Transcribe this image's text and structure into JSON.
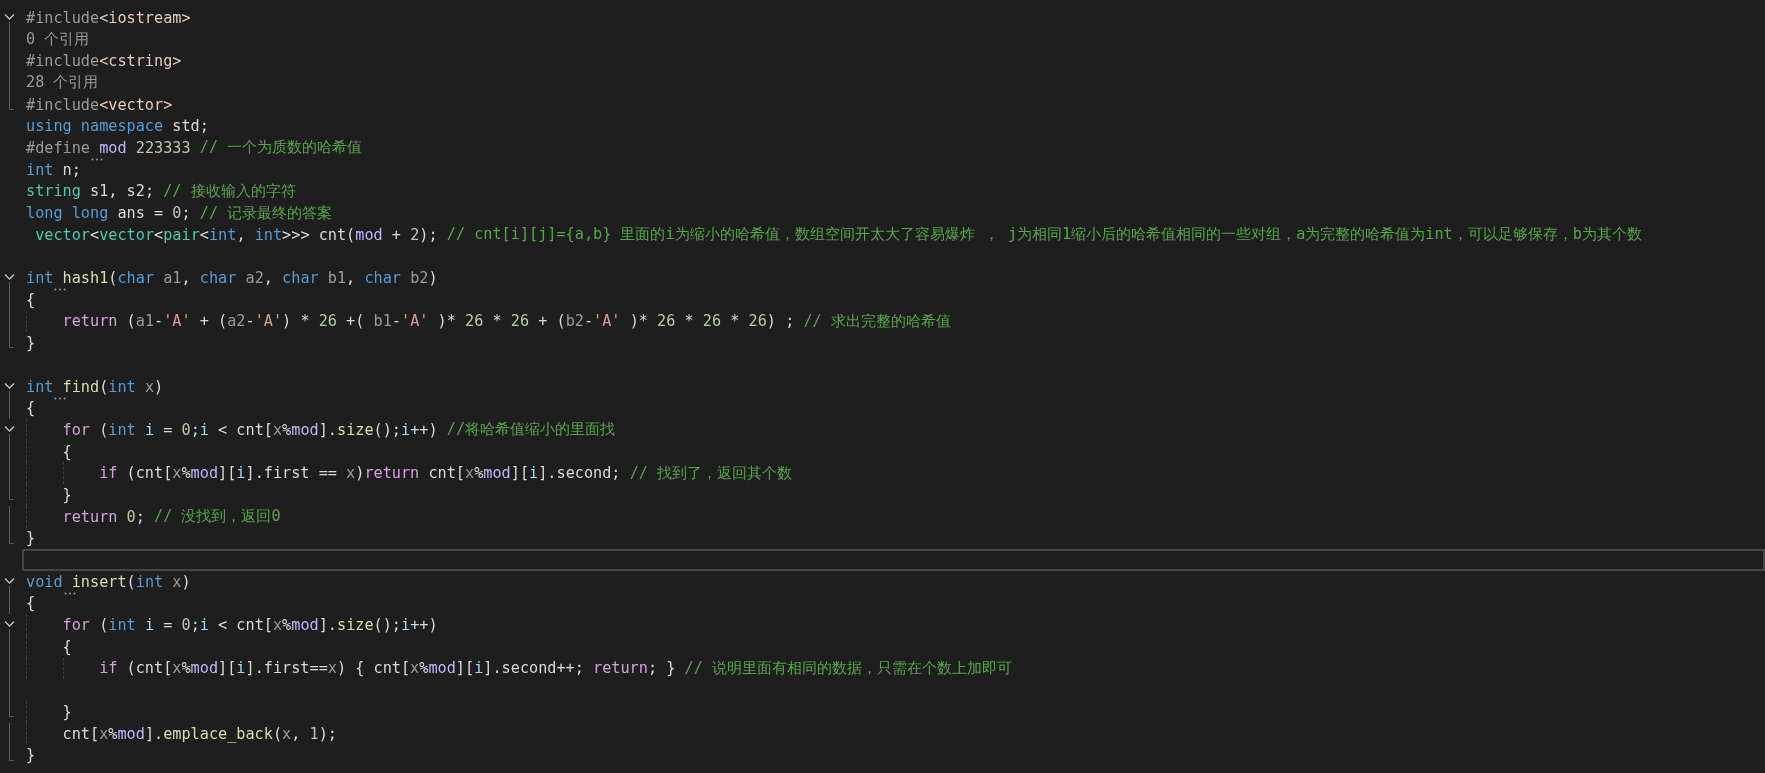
{
  "editor": {
    "lines": [
      {
        "fold_start": true,
        "fold_body": false,
        "fold_end": false,
        "current": false,
        "tokens": [
          {
            "t": "#include",
            "kind": "preprocessor"
          },
          {
            "t": "<iostream>",
            "kind": "include-path"
          }
        ]
      },
      {
        "fold_start": false,
        "fold_body": true,
        "fold_end": false,
        "current": false,
        "tokens": [
          {
            "t": "0 个引用",
            "kind": "codelens"
          }
        ]
      },
      {
        "fold_start": false,
        "fold_body": true,
        "fold_end": false,
        "current": false,
        "tokens": [
          {
            "t": "#include",
            "kind": "preprocessor"
          },
          {
            "t": "<cstring>",
            "kind": "include-path"
          }
        ]
      },
      {
        "fold_start": false,
        "fold_body": true,
        "fold_end": false,
        "current": false,
        "tokens": [
          {
            "t": "28 个引用",
            "kind": "codelens"
          }
        ]
      },
      {
        "fold_start": false,
        "fold_body": false,
        "fold_end": true,
        "current": false,
        "tokens": [
          {
            "t": "#include",
            "kind": "preprocessor"
          },
          {
            "t": "<vector>",
            "kind": "include-path"
          }
        ]
      },
      {
        "fold_start": false,
        "fold_body": false,
        "fold_end": false,
        "current": false,
        "tokens": [
          {
            "t": "using",
            "kind": "keyword"
          },
          {
            "t": " namespace",
            "kind": "keyword"
          },
          {
            "t": " std;",
            "kind": "plain"
          }
        ]
      },
      {
        "fold_start": false,
        "fold_body": false,
        "fold_end": false,
        "current": false,
        "tokens": [
          {
            "t": "#define",
            "kind": "preprocessor"
          },
          {
            "t": " mod",
            "kind": "macro",
            "hint": true
          },
          {
            "t": " 223333",
            "kind": "number"
          },
          {
            "t": " // 一个为质数的哈希值",
            "kind": "comment"
          }
        ]
      },
      {
        "fold_start": false,
        "fold_body": false,
        "fold_end": false,
        "current": false,
        "tokens": [
          {
            "t": "int",
            "kind": "keyword"
          },
          {
            "t": " n;",
            "kind": "plain"
          }
        ]
      },
      {
        "fold_start": false,
        "fold_body": false,
        "fold_end": false,
        "current": false,
        "tokens": [
          {
            "t": "string",
            "kind": "type"
          },
          {
            "t": " s1, s2;",
            "kind": "plain"
          },
          {
            "t": " // 接收输入的字符",
            "kind": "comment"
          }
        ]
      },
      {
        "fold_start": false,
        "fold_body": false,
        "fold_end": false,
        "current": false,
        "tokens": [
          {
            "t": "long long",
            "kind": "keyword"
          },
          {
            "t": " ans = ",
            "kind": "plain"
          },
          {
            "t": "0",
            "kind": "number"
          },
          {
            "t": ";",
            "kind": "plain"
          },
          {
            "t": " // 记录最终的答案",
            "kind": "comment"
          }
        ]
      },
      {
        "fold_start": false,
        "fold_body": false,
        "fold_end": false,
        "current": false,
        "tokens": [
          {
            "t": " vector",
            "kind": "type"
          },
          {
            "t": "<",
            "kind": "plain"
          },
          {
            "t": "vector",
            "kind": "type"
          },
          {
            "t": "<",
            "kind": "plain"
          },
          {
            "t": "pair",
            "kind": "type"
          },
          {
            "t": "<",
            "kind": "plain"
          },
          {
            "t": "int",
            "kind": "keyword"
          },
          {
            "t": ", ",
            "kind": "plain"
          },
          {
            "t": "int",
            "kind": "keyword"
          },
          {
            "t": ">>> cnt(",
            "kind": "plain"
          },
          {
            "t": "mod",
            "kind": "macro"
          },
          {
            "t": " + ",
            "kind": "plain"
          },
          {
            "t": "2",
            "kind": "number"
          },
          {
            "t": ");",
            "kind": "plain"
          },
          {
            "t": " // cnt[i][j]={a,b} 里面的i为缩小的哈希值，数组空间开太大了容易爆炸 ， j为相同1缩小后的哈希值相同的一些对组，a为完整的哈希值为int，可以足够保存，b为其个数",
            "kind": "comment"
          }
        ]
      },
      {
        "fold_start": false,
        "fold_body": false,
        "fold_end": false,
        "current": false
      },
      {
        "fold_start": true,
        "fold_body": false,
        "fold_end": false,
        "current": false,
        "tokens": [
          {
            "t": "int",
            "kind": "keyword"
          },
          {
            "t": " hash1",
            "kind": "function",
            "hint": true
          },
          {
            "t": "(",
            "kind": "plain"
          },
          {
            "t": "char",
            "kind": "keyword"
          },
          {
            "t": " a1",
            "kind": "parameter"
          },
          {
            "t": ", ",
            "kind": "plain"
          },
          {
            "t": "char",
            "kind": "keyword"
          },
          {
            "t": " a2",
            "kind": "parameter"
          },
          {
            "t": ", ",
            "kind": "plain"
          },
          {
            "t": "char",
            "kind": "keyword"
          },
          {
            "t": " b1",
            "kind": "parameter"
          },
          {
            "t": ", ",
            "kind": "plain"
          },
          {
            "t": "char",
            "kind": "keyword"
          },
          {
            "t": " b2",
            "kind": "parameter"
          },
          {
            "t": ")",
            "kind": "plain"
          }
        ]
      },
      {
        "fold_start": false,
        "fold_body": true,
        "fold_end": false,
        "current": false,
        "tokens": [
          {
            "t": "{",
            "kind": "plain"
          }
        ]
      },
      {
        "fold_start": false,
        "fold_body": true,
        "fold_end": false,
        "current": false,
        "tokens": [
          {
            "t": "    return",
            "kind": "control"
          },
          {
            "t": " (",
            "kind": "plain"
          },
          {
            "t": "a1",
            "kind": "parameter"
          },
          {
            "t": "-",
            "kind": "plain"
          },
          {
            "t": "'A'",
            "kind": "string"
          },
          {
            "t": " + (",
            "kind": "plain"
          },
          {
            "t": "a2",
            "kind": "parameter"
          },
          {
            "t": "-",
            "kind": "plain"
          },
          {
            "t": "'A'",
            "kind": "string"
          },
          {
            "t": ") * ",
            "kind": "plain"
          },
          {
            "t": "26",
            "kind": "number"
          },
          {
            "t": " +( ",
            "kind": "plain"
          },
          {
            "t": "b1",
            "kind": "parameter"
          },
          {
            "t": "-",
            "kind": "plain"
          },
          {
            "t": "'A'",
            "kind": "string"
          },
          {
            "t": " )* ",
            "kind": "plain"
          },
          {
            "t": "26",
            "kind": "number"
          },
          {
            "t": " * ",
            "kind": "plain"
          },
          {
            "t": "26",
            "kind": "number"
          },
          {
            "t": " + (",
            "kind": "plain"
          },
          {
            "t": "b2",
            "kind": "parameter"
          },
          {
            "t": "-",
            "kind": "plain"
          },
          {
            "t": "'A'",
            "kind": "string"
          },
          {
            "t": " )* ",
            "kind": "plain"
          },
          {
            "t": "26",
            "kind": "number"
          },
          {
            "t": " * ",
            "kind": "plain"
          },
          {
            "t": "26",
            "kind": "number"
          },
          {
            "t": " * ",
            "kind": "plain"
          },
          {
            "t": "26",
            "kind": "number"
          },
          {
            "t": ") ; ",
            "kind": "plain"
          },
          {
            "t": "// 求出完整的哈希值",
            "kind": "comment"
          }
        ]
      },
      {
        "fold_start": false,
        "fold_body": false,
        "fold_end": true,
        "current": false,
        "tokens": [
          {
            "t": "}",
            "kind": "plain"
          }
        ]
      },
      {
        "fold_start": false,
        "fold_body": false,
        "fold_end": false,
        "current": false
      },
      {
        "fold_start": true,
        "fold_body": false,
        "fold_end": false,
        "current": false,
        "tokens": [
          {
            "t": "int",
            "kind": "keyword"
          },
          {
            "t": " find",
            "kind": "function",
            "hint": true
          },
          {
            "t": "(",
            "kind": "plain"
          },
          {
            "t": "int",
            "kind": "keyword"
          },
          {
            "t": " x",
            "kind": "parameter"
          },
          {
            "t": ")",
            "kind": "plain"
          }
        ]
      },
      {
        "fold_start": false,
        "fold_body": true,
        "fold_end": false,
        "current": false,
        "tokens": [
          {
            "t": "{",
            "kind": "plain"
          }
        ]
      },
      {
        "fold_start": true,
        "fold_body": false,
        "fold_end": false,
        "current": false,
        "tokens": [
          {
            "t": "    for",
            "kind": "control"
          },
          {
            "t": " (",
            "kind": "plain"
          },
          {
            "t": "int",
            "kind": "keyword"
          },
          {
            "t": " i",
            "kind": "variable"
          },
          {
            "t": " = ",
            "kind": "plain"
          },
          {
            "t": "0",
            "kind": "number"
          },
          {
            "t": ";",
            "kind": "plain"
          },
          {
            "t": "i",
            "kind": "variable"
          },
          {
            "t": " < cnt[",
            "kind": "plain"
          },
          {
            "t": "x",
            "kind": "parameter"
          },
          {
            "t": "%",
            "kind": "plain"
          },
          {
            "t": "mod",
            "kind": "macro"
          },
          {
            "t": "].",
            "kind": "plain"
          },
          {
            "t": "size",
            "kind": "function"
          },
          {
            "t": "();",
            "kind": "plain"
          },
          {
            "t": "i",
            "kind": "variable"
          },
          {
            "t": "++) ",
            "kind": "plain"
          },
          {
            "t": "//将哈希值缩小的里面找",
            "kind": "comment"
          }
        ]
      },
      {
        "fold_start": false,
        "fold_body": true,
        "fold_end": false,
        "current": false,
        "tokens": [
          {
            "t": "    {",
            "kind": "plain"
          }
        ]
      },
      {
        "fold_start": false,
        "fold_body": true,
        "fold_end": false,
        "current": false,
        "tokens": [
          {
            "t": "        if",
            "kind": "control"
          },
          {
            "t": " (cnt[",
            "kind": "plain"
          },
          {
            "t": "x",
            "kind": "parameter"
          },
          {
            "t": "%",
            "kind": "plain"
          },
          {
            "t": "mod",
            "kind": "macro"
          },
          {
            "t": "][",
            "kind": "plain"
          },
          {
            "t": "i",
            "kind": "variable"
          },
          {
            "t": "].first == ",
            "kind": "plain"
          },
          {
            "t": "x",
            "kind": "parameter"
          },
          {
            "t": ")",
            "kind": "plain"
          },
          {
            "t": "return",
            "kind": "control"
          },
          {
            "t": " cnt[",
            "kind": "plain"
          },
          {
            "t": "x",
            "kind": "parameter"
          },
          {
            "t": "%",
            "kind": "plain"
          },
          {
            "t": "mod",
            "kind": "macro"
          },
          {
            "t": "][",
            "kind": "plain"
          },
          {
            "t": "i",
            "kind": "variable"
          },
          {
            "t": "].second; ",
            "kind": "plain"
          },
          {
            "t": "// 找到了，返回其个数",
            "kind": "comment"
          }
        ]
      },
      {
        "fold_start": false,
        "fold_body": false,
        "fold_end": true,
        "current": false,
        "tokens": [
          {
            "t": "    }",
            "kind": "plain"
          }
        ]
      },
      {
        "fold_start": false,
        "fold_body": true,
        "fold_end": false,
        "current": false,
        "tokens": [
          {
            "t": "    return",
            "kind": "control"
          },
          {
            "t": " 0",
            "kind": "number"
          },
          {
            "t": "; ",
            "kind": "plain"
          },
          {
            "t": "// 没找到，返回0",
            "kind": "comment"
          }
        ]
      },
      {
        "fold_start": false,
        "fold_body": false,
        "fold_end": true,
        "current": false,
        "tokens": [
          {
            "t": "}",
            "kind": "plain"
          }
        ]
      },
      {
        "fold_start": false,
        "fold_body": false,
        "fold_end": false,
        "current": true
      },
      {
        "fold_start": true,
        "fold_body": false,
        "fold_end": false,
        "current": false,
        "tokens": [
          {
            "t": "void",
            "kind": "keyword"
          },
          {
            "t": " insert",
            "kind": "function",
            "hint": true
          },
          {
            "t": "(",
            "kind": "plain"
          },
          {
            "t": "int",
            "kind": "keyword"
          },
          {
            "t": " x",
            "kind": "parameter"
          },
          {
            "t": ")",
            "kind": "plain"
          }
        ]
      },
      {
        "fold_start": false,
        "fold_body": true,
        "fold_end": false,
        "current": false,
        "tokens": [
          {
            "t": "{",
            "kind": "plain"
          }
        ]
      },
      {
        "fold_start": true,
        "fold_body": false,
        "fold_end": false,
        "current": false,
        "tokens": [
          {
            "t": "    for",
            "kind": "control"
          },
          {
            "t": " (",
            "kind": "plain"
          },
          {
            "t": "int",
            "kind": "keyword"
          },
          {
            "t": " i",
            "kind": "variable"
          },
          {
            "t": " = ",
            "kind": "plain"
          },
          {
            "t": "0",
            "kind": "number"
          },
          {
            "t": ";",
            "kind": "plain"
          },
          {
            "t": "i",
            "kind": "variable"
          },
          {
            "t": " < cnt[",
            "kind": "plain"
          },
          {
            "t": "x",
            "kind": "parameter"
          },
          {
            "t": "%",
            "kind": "plain"
          },
          {
            "t": "mod",
            "kind": "macro"
          },
          {
            "t": "].",
            "kind": "plain"
          },
          {
            "t": "size",
            "kind": "function"
          },
          {
            "t": "();",
            "kind": "plain"
          },
          {
            "t": "i",
            "kind": "variable"
          },
          {
            "t": "++)",
            "kind": "plain"
          }
        ]
      },
      {
        "fold_start": false,
        "fold_body": true,
        "fold_end": false,
        "current": false,
        "tokens": [
          {
            "t": "    {",
            "kind": "plain"
          }
        ]
      },
      {
        "fold_start": false,
        "fold_body": true,
        "fold_end": false,
        "current": false,
        "tokens": [
          {
            "t": "        if",
            "kind": "control"
          },
          {
            "t": " (cnt[",
            "kind": "plain"
          },
          {
            "t": "x",
            "kind": "parameter"
          },
          {
            "t": "%",
            "kind": "plain"
          },
          {
            "t": "mod",
            "kind": "macro"
          },
          {
            "t": "][",
            "kind": "plain"
          },
          {
            "t": "i",
            "kind": "variable"
          },
          {
            "t": "].first==",
            "kind": "plain"
          },
          {
            "t": "x",
            "kind": "parameter"
          },
          {
            "t": ") { cnt[",
            "kind": "plain"
          },
          {
            "t": "x",
            "kind": "parameter"
          },
          {
            "t": "%",
            "kind": "plain"
          },
          {
            "t": "mod",
            "kind": "macro"
          },
          {
            "t": "][",
            "kind": "plain"
          },
          {
            "t": "i",
            "kind": "variable"
          },
          {
            "t": "].second++; ",
            "kind": "plain"
          },
          {
            "t": "return",
            "kind": "control"
          },
          {
            "t": "; } ",
            "kind": "plain"
          },
          {
            "t": "// 说明里面有相同的数据，只需在个数上加即可",
            "kind": "comment"
          }
        ]
      },
      {
        "fold_start": false,
        "fold_body": true,
        "fold_end": false,
        "current": false
      },
      {
        "fold_start": false,
        "fold_body": false,
        "fold_end": true,
        "current": false,
        "tokens": [
          {
            "t": "    }",
            "kind": "plain"
          }
        ]
      },
      {
        "fold_start": false,
        "fold_body": true,
        "fold_end": false,
        "current": false,
        "tokens": [
          {
            "t": "    cnt[",
            "kind": "plain"
          },
          {
            "t": "x",
            "kind": "parameter"
          },
          {
            "t": "%",
            "kind": "plain"
          },
          {
            "t": "mod",
            "kind": "macro"
          },
          {
            "t": "].",
            "kind": "plain"
          },
          {
            "t": "emplace_back",
            "kind": "function"
          },
          {
            "t": "(",
            "kind": "plain"
          },
          {
            "t": "x",
            "kind": "parameter"
          },
          {
            "t": ", ",
            "kind": "plain"
          },
          {
            "t": "1",
            "kind": "number"
          },
          {
            "t": ");",
            "kind": "plain"
          }
        ]
      },
      {
        "fold_start": false,
        "fold_body": false,
        "fold_end": true,
        "current": false,
        "tokens": [
          {
            "t": "}",
            "kind": "plain"
          }
        ]
      }
    ]
  }
}
